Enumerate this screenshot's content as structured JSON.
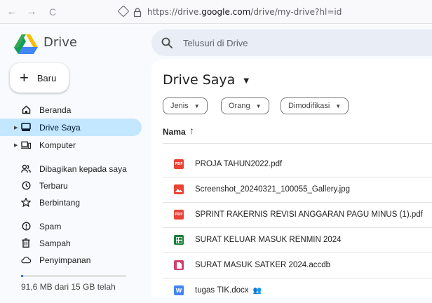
{
  "browser": {
    "back": "←",
    "forward": "→",
    "reload": "C",
    "url_prefix": "https://drive.",
    "url_domain": "google.com",
    "url_suffix": "/drive/my-drive?hl=id"
  },
  "app": {
    "brand": "Drive",
    "search_placeholder": "Telusuri di Drive"
  },
  "sidebar": {
    "new_label": "Baru",
    "items": [
      {
        "label": "Beranda",
        "icon": "home-icon"
      },
      {
        "label": "Drive Saya",
        "icon": "my-drive-icon",
        "active": true
      },
      {
        "label": "Komputer",
        "icon": "computer-icon"
      },
      {
        "label": "Dibagikan kepada saya",
        "icon": "shared-icon"
      },
      {
        "label": "Terbaru",
        "icon": "clock-icon"
      },
      {
        "label": "Berbintang",
        "icon": "star-icon"
      },
      {
        "label": "Spam",
        "icon": "spam-icon"
      },
      {
        "label": "Sampah",
        "icon": "trash-icon"
      },
      {
        "label": "Penyimpanan",
        "icon": "cloud-icon"
      }
    ],
    "storage_text": "91,6 MB dari 15 GB telah",
    "storage_fraction": 0.006
  },
  "main": {
    "title": "Drive Saya",
    "filters": [
      "Jenis",
      "Orang",
      "Dimodifikasi"
    ],
    "column_name": "Nama",
    "files": [
      {
        "name": "PROJA TAHUN2022.pdf",
        "type": "pdf"
      },
      {
        "name": "Screenshot_20240321_100055_Gallery.jpg",
        "type": "image"
      },
      {
        "name": "SPRINT RAKERNIS REVISI ANGGARAN PAGU MINUS (1).pdf",
        "type": "pdf"
      },
      {
        "name": "SURAT KELUAR MASUK RENMIN 2024",
        "type": "sheet"
      },
      {
        "name": "SURAT MASUK SATKER 2024.accdb",
        "type": "access"
      },
      {
        "name": "tugas TIK.docx",
        "type": "word",
        "shared": true
      }
    ]
  },
  "colors": {
    "active_bg": "#c2e7ff",
    "pdf": "#ea4335",
    "image": "#ea4335",
    "sheet": "#188038",
    "access": "#d0416d",
    "word": "#4285f4"
  }
}
